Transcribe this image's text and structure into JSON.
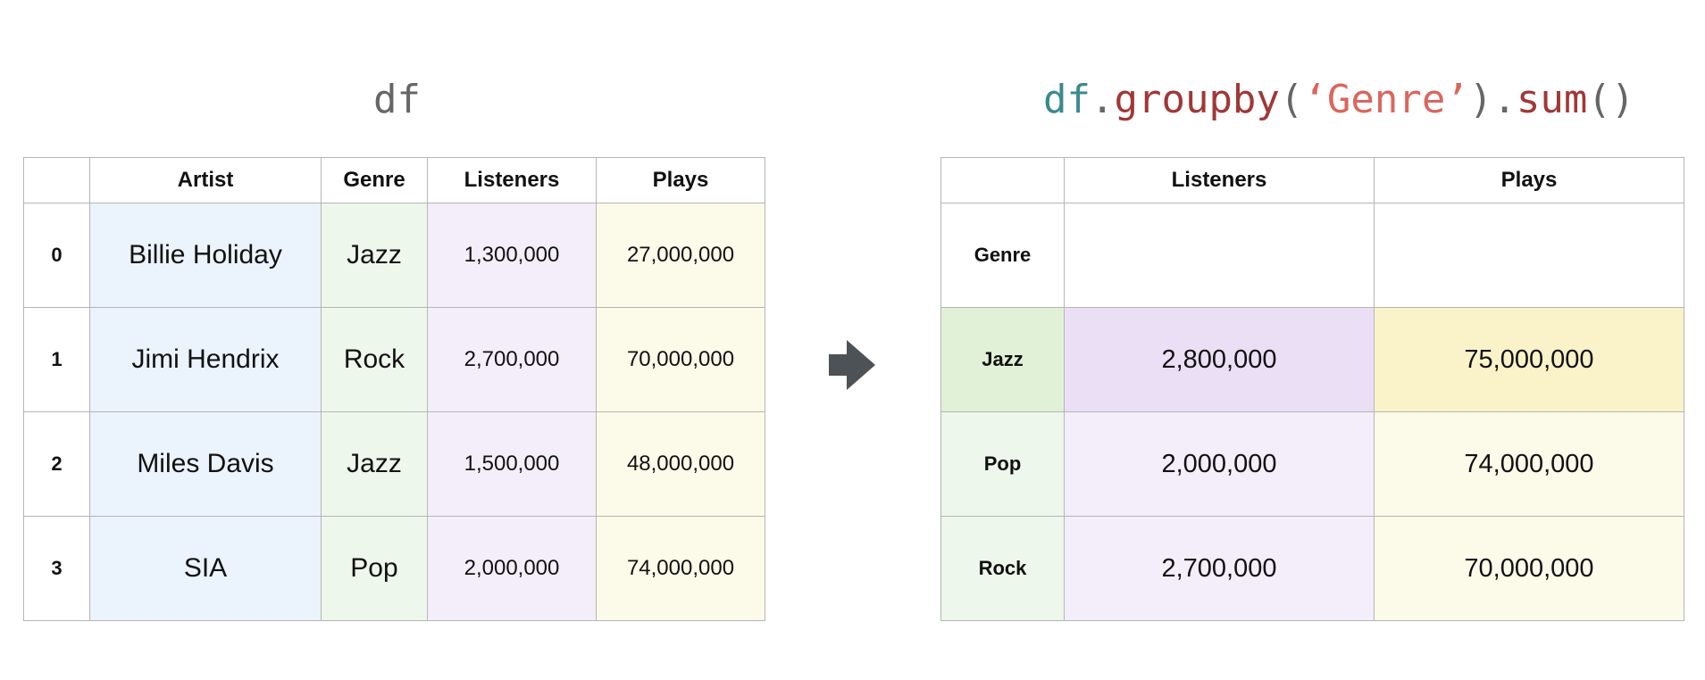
{
  "left": {
    "title": "df",
    "headers": [
      "",
      "Artist",
      "Genre",
      "Listeners",
      "Plays"
    ],
    "rows": [
      {
        "index": "0",
        "artist": "Billie Holiday",
        "genre": "Jazz",
        "listeners": "1,300,000",
        "plays": "27,000,000"
      },
      {
        "index": "1",
        "artist": "Jimi Hendrix",
        "genre": "Rock",
        "listeners": "2,700,000",
        "plays": "70,000,000"
      },
      {
        "index": "2",
        "artist": "Miles Davis",
        "genre": "Jazz",
        "listeners": "1,500,000",
        "plays": "48,000,000"
      },
      {
        "index": "3",
        "artist": "SIA",
        "genre": "Pop",
        "listeners": "2,000,000",
        "plays": "74,000,000"
      }
    ]
  },
  "right": {
    "title_parts": [
      "df",
      ".",
      "groupby",
      "(",
      "‘Genre’",
      ")",
      ".",
      "sum",
      "()"
    ],
    "headers": [
      "",
      "Listeners",
      "Plays"
    ],
    "index_name": "Genre",
    "rows": [
      {
        "genre": "Jazz",
        "listeners": "2,800,000",
        "plays": "75,000,000"
      },
      {
        "genre": "Pop",
        "listeners": "2,000,000",
        "plays": "74,000,000"
      },
      {
        "genre": "Rock",
        "listeners": "2,700,000",
        "plays": "70,000,000"
      }
    ]
  },
  "arrow": {
    "icon": "right-arrow-icon",
    "color": "#4d5257"
  },
  "colors": {
    "artist_col": "#ebf3fd",
    "genre_col": "#eef7eb",
    "listeners_col": "#f3eefa",
    "plays_col": "#fcfbea",
    "highlight_genre": "#e0f1d8",
    "highlight_listeners": "#ebdff5",
    "highlight_plays": "#faf3c9"
  }
}
